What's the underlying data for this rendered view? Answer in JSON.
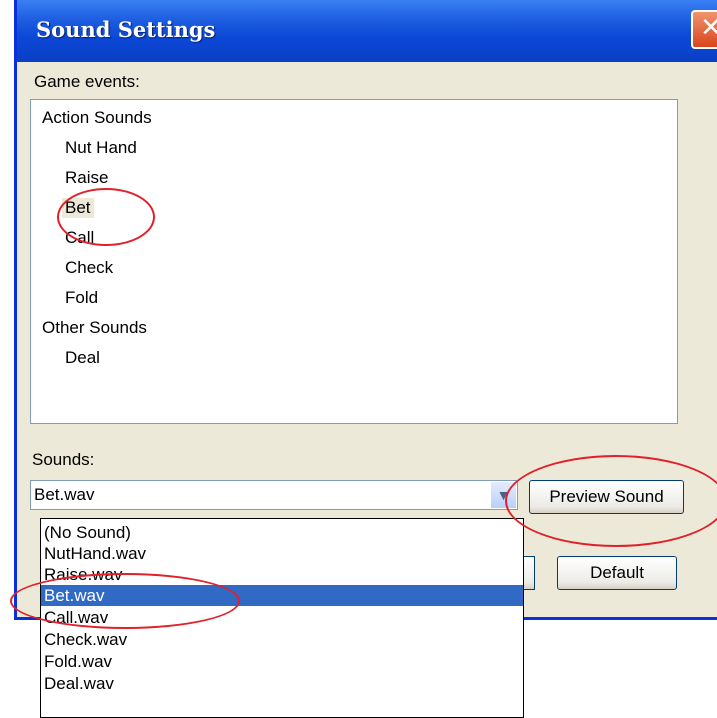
{
  "window": {
    "title": "Sound Settings",
    "close_glyph": "✕"
  },
  "events": {
    "label": "Game events:",
    "items": [
      {
        "label": "Action Sounds",
        "level": 0
      },
      {
        "label": "Nut Hand",
        "level": 1
      },
      {
        "label": "Raise",
        "level": 1
      },
      {
        "label": "Bet",
        "level": 1,
        "selected": true
      },
      {
        "label": "Call",
        "level": 1
      },
      {
        "label": "Check",
        "level": 1
      },
      {
        "label": "Fold",
        "level": 1
      },
      {
        "label": "Other Sounds",
        "level": 0
      },
      {
        "label": "Deal",
        "level": 1
      }
    ]
  },
  "sounds": {
    "label": "Sounds:",
    "selected_value": "Bet.wav",
    "options": [
      "(No Sound)",
      "NutHand.wav",
      "Raise.wav",
      "Bet.wav",
      "Call.wav",
      "Check.wav",
      "Fold.wav",
      "Deal.wav"
    ],
    "highlighted_option": "Bet.wav"
  },
  "buttons": {
    "preview": "Preview Sound",
    "default": "Default"
  },
  "colors": {
    "annotation": "#e0202a",
    "selection": "#316ac5",
    "title_bar": "#0b48d7"
  },
  "icons": {
    "close": "close-icon",
    "dropdown_arrow": "chevron-down-icon"
  }
}
